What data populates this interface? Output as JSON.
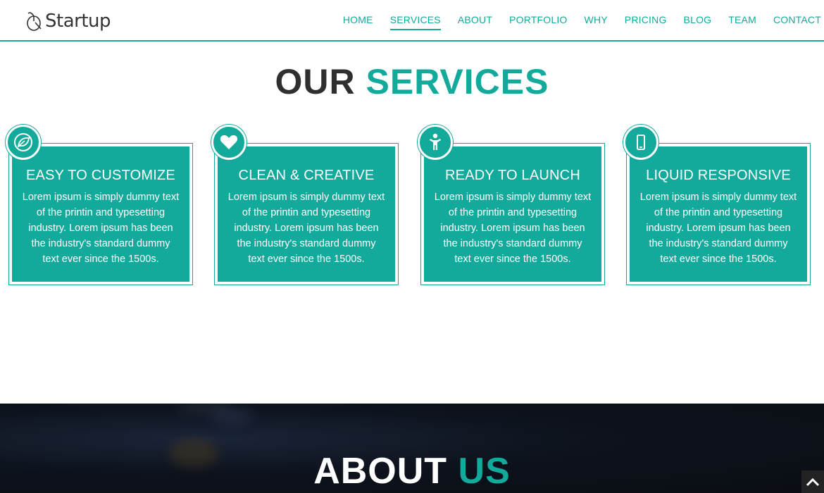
{
  "header": {
    "logo_text": "Startup",
    "nav": [
      {
        "label": "HOME"
      },
      {
        "label": "SERVICES",
        "active": true
      },
      {
        "label": "ABOUT"
      },
      {
        "label": "PORTFOLIO"
      },
      {
        "label": "WHY"
      },
      {
        "label": "PRICING"
      },
      {
        "label": "BLOG"
      },
      {
        "label": "TEAM"
      },
      {
        "label": "CONTACT"
      }
    ]
  },
  "services": {
    "title_dark": "OUR",
    "title_accent": "SERVICES",
    "cards": [
      {
        "icon": "leaf-icon",
        "title": "EASY TO CUSTOMIZE",
        "text": "Lorem ipsum is simply dummy text of the printin and typesetting industry. Lorem ipsum has been the industry's standard dummy text ever since the 1500s."
      },
      {
        "icon": "heart-icon",
        "title": "CLEAN & CREATIVE",
        "text": "Lorem ipsum is simply dummy text of the printin and typesetting industry. Lorem ipsum has been the industry's standard dummy text ever since the 1500s."
      },
      {
        "icon": "person-icon",
        "title": "READY TO LAUNCH",
        "text": "Lorem ipsum is simply dummy text of the printin and typesetting industry. Lorem ipsum has been the industry's standard dummy text ever since the 1500s."
      },
      {
        "icon": "mobile-icon",
        "title": "LIQUID RESPONSIVE",
        "text": "Lorem ipsum is simply dummy text of the printin and typesetting industry. Lorem ipsum has been the industry's standard dummy text ever since the 1500s."
      }
    ]
  },
  "about": {
    "title_dark": "ABOUT",
    "title_accent": "US"
  },
  "colors": {
    "accent": "#13a99b",
    "dark_text": "#2f2f2f",
    "about_bg": "#0d121b"
  },
  "scroll_top_icon": "chevron-up-icon"
}
